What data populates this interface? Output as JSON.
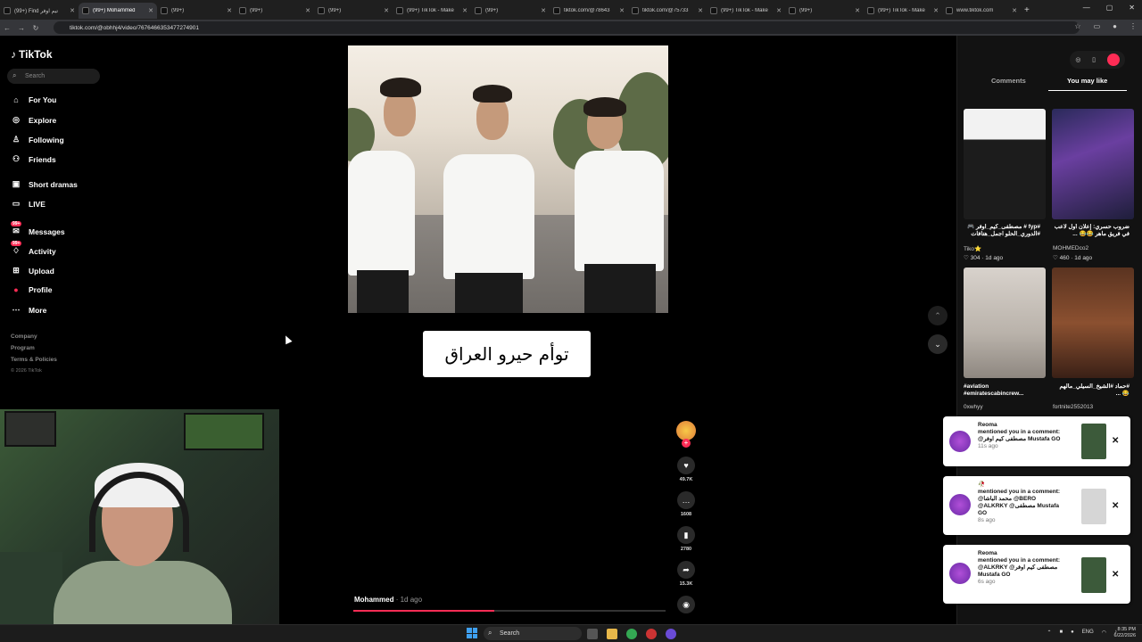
{
  "browser": {
    "tabs": [
      {
        "label": "(99+) Find تيم اوفر"
      },
      {
        "label": "(99+) Mohammed"
      },
      {
        "label": "(99+)"
      },
      {
        "label": "(99+)"
      },
      {
        "label": "(99+)"
      },
      {
        "label": "(99+) TikTok - Make"
      },
      {
        "label": "(99+)"
      },
      {
        "label": "tiktok.com/@78643"
      },
      {
        "label": "tiktok.com/@75733"
      },
      {
        "label": "(99+) TikTok - Make"
      },
      {
        "label": "(99+)"
      },
      {
        "label": "(99+) TikTok - Make"
      },
      {
        "label": "www.tiktok.com"
      }
    ],
    "url": "tiktok.com/@obhhj4/video/7676466353477274901"
  },
  "sidebar": {
    "brand": "TikTok",
    "search_placeholder": "Search",
    "items": [
      {
        "label": "For You",
        "icon": "home-icon"
      },
      {
        "label": "Explore",
        "icon": "compass-icon"
      },
      {
        "label": "Following",
        "icon": "user-icon"
      },
      {
        "label": "Friends",
        "icon": "friends-icon"
      },
      {
        "label": "Short dramas",
        "icon": "drama-icon"
      },
      {
        "label": "LIVE",
        "icon": "live-icon"
      },
      {
        "label": "Messages",
        "icon": "message-icon",
        "badge": "99+"
      },
      {
        "label": "Activity",
        "icon": "activity-icon",
        "badge": "99+"
      },
      {
        "label": "Upload",
        "icon": "upload-icon"
      },
      {
        "label": "Profile",
        "icon": "profile-icon"
      },
      {
        "label": "More",
        "icon": "more-icon"
      }
    ],
    "footer": {
      "company": "Company",
      "program": "Program",
      "terms": "Terms & Policies",
      "copyright": "© 2026 TikTok"
    }
  },
  "video": {
    "caption_overlay": "توأم حيرو العراق",
    "author": "Mohammed",
    "posted": "· 1d ago",
    "progress": 0.45,
    "likes": "49.7K",
    "comments": "1608",
    "saves": "2780",
    "shares": "15.3K"
  },
  "right_panel": {
    "tabs": [
      "Comments",
      "You may like"
    ],
    "active_tab": "You may like",
    "items": [
      {
        "desc": "#fyp # مصطفى_كيم_اوفر 🎮 #الدوري_الحلو اجمل_هتافات",
        "user": "Tiko⭐",
        "likes": "304",
        "ago": "1d ago"
      },
      {
        "desc": "ضروب حسري: إعلان أول لاعب في فريق ماهر 😂😂 ...",
        "user": "MOHMEDco2",
        "likes": "460",
        "ago": "1d ago"
      },
      {
        "desc": "#aviation #emiratescabincrew...",
        "user": "0xwhyy"
      },
      {
        "desc": "#حماد #الشيخ_السيلي_مالهم 😂 ...",
        "user": "fortnite2552013"
      }
    ]
  },
  "notifications": [
    {
      "user": "Reoma",
      "text": "mentioned you in a comment: @مصطفى كيم اوفر Mustafa GO",
      "ago": "11s ago"
    },
    {
      "user": "🥀",
      "text": "mentioned you in a comment: @محمد الباشا @BERO @ALKRKY @مصطفى Mustafa GO",
      "ago": "8s ago"
    },
    {
      "user": "Reoma",
      "text": "mentioned you in a comment: @ALKRKY @مصطفى كيم اوفر Mustafa GO",
      "ago": "6s ago"
    }
  ],
  "taskbar": {
    "search": "Search",
    "lang": "ENG",
    "time": "8:35 PM",
    "date": "6/22/2026"
  }
}
